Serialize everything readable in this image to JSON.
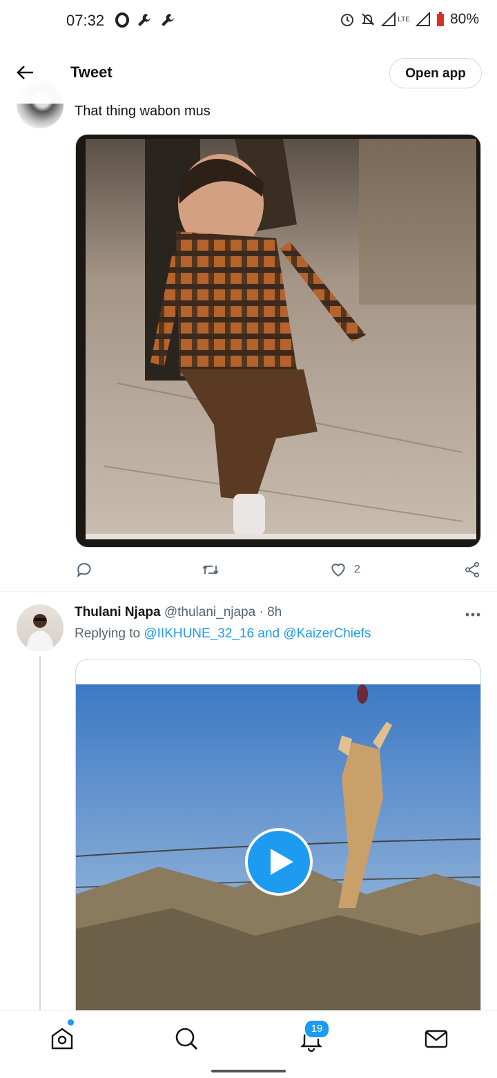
{
  "status_bar": {
    "time": "07:32",
    "battery": "80%",
    "network": "LTE"
  },
  "header": {
    "title": "Tweet",
    "open_app_label": "Open app"
  },
  "tweet1": {
    "text": "That thing wabon mus",
    "actions": {
      "reply_count": "",
      "retweet_count": "",
      "like_count": "2"
    }
  },
  "tweet2": {
    "name": "Thulani Njapa",
    "handle": "@thulani_njapa",
    "sep": " · ",
    "time": "8h",
    "replying_prefix": "Replying to ",
    "mention_1": "@IIKHUNE_32_16",
    "and_text": " and ",
    "mention_2": "@KaizerChiefs"
  },
  "bottom_nav": {
    "notifications_badge": "19"
  },
  "colors": {
    "accent": "#1d9bf0",
    "text": "#0f1419",
    "muted": "#536471"
  }
}
